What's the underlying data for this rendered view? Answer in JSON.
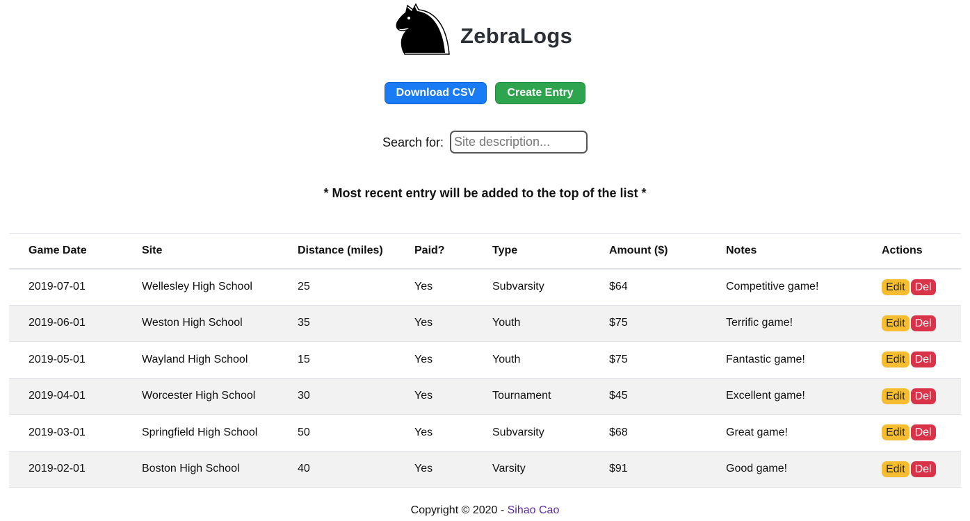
{
  "app": {
    "title": "ZebraLogs",
    "logo_icon": "chess-knight-icon"
  },
  "toolbar": {
    "download_label": "Download CSV",
    "create_label": "Create Entry"
  },
  "search": {
    "label": "Search for:",
    "placeholder": "Site description...",
    "value": ""
  },
  "notice": "* Most recent entry will be added to the top of the list *",
  "table": {
    "headers": [
      "Game Date",
      "Site",
      "Distance (miles)",
      "Paid?",
      "Type",
      "Amount ($)",
      "Notes",
      "Actions"
    ],
    "rows": [
      [
        "2019-07-01",
        "Wellesley High School",
        "25",
        "Yes",
        "Subvarsity",
        "$64",
        "Competitive game!"
      ],
      [
        "2019-06-01",
        "Weston High School",
        "35",
        "Yes",
        "Youth",
        "$75",
        "Terrific game!"
      ],
      [
        "2019-05-01",
        "Wayland High School",
        "15",
        "Yes",
        "Youth",
        "$75",
        "Fantastic game!"
      ],
      [
        "2019-04-01",
        "Worcester High School",
        "30",
        "Yes",
        "Tournament",
        "$45",
        "Excellent game!"
      ],
      [
        "2019-03-01",
        "Springfield High School",
        "50",
        "Yes",
        "Subvarsity",
        "$68",
        "Great game!"
      ],
      [
        "2019-02-01",
        "Boston High School",
        "40",
        "Yes",
        "Varsity",
        "$91",
        "Good game!"
      ]
    ],
    "edit_label": "Edit",
    "delete_label": "Del"
  },
  "footer": {
    "copyright": "Copyright © 2020 - ",
    "author": "Sihao Cao"
  },
  "colors": {
    "blue": "#1a7cf5",
    "green": "#2ea44f",
    "edit": "#f5bd2f",
    "delete": "#d9334a",
    "link": "#5b2a9a"
  }
}
